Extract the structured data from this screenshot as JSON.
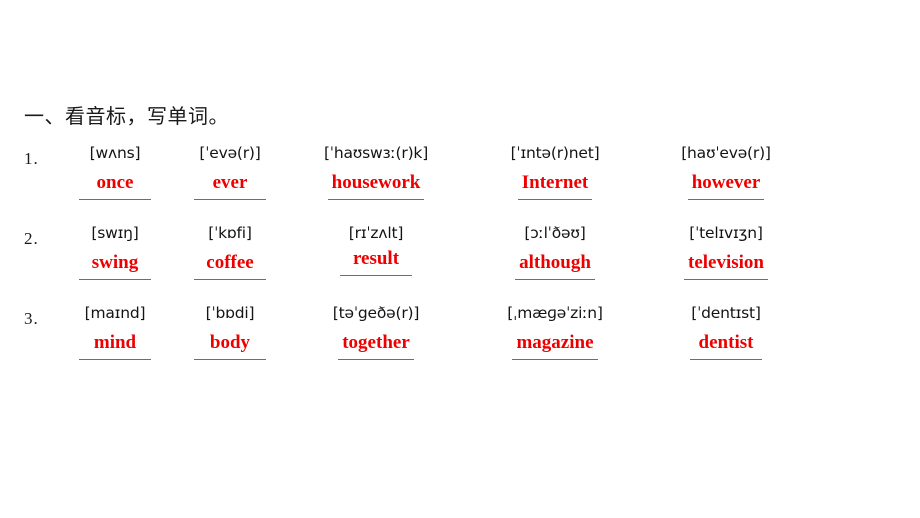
{
  "title": "一、看音标，写单词。",
  "accent_color": "#ee0000",
  "text_color": "#141414",
  "rule_color": "#6e6e6e",
  "background": "#ffffff",
  "rows": [
    {
      "number": "1.",
      "items": [
        {
          "phonetic": "[wʌns]",
          "answer": "once"
        },
        {
          "phonetic": "[ˈevə(r)]",
          "answer": "ever"
        },
        {
          "phonetic": "[ˈhaʊswɜː(r)k]",
          "answer": "housework"
        },
        {
          "phonetic": "[ˈɪntə(r)net]",
          "answer": "Internet"
        },
        {
          "phonetic": "[haʊˈevə(r)]",
          "answer": "however"
        }
      ]
    },
    {
      "number": "2.",
      "items": [
        {
          "phonetic": "[swɪŋ]",
          "answer": "swing"
        },
        {
          "phonetic": "[ˈkɒfi]",
          "answer": "coffee"
        },
        {
          "phonetic": "[rɪˈzʌlt]",
          "answer": "result"
        },
        {
          "phonetic": "[ɔːlˈðəʊ]",
          "answer": "although"
        },
        {
          "phonetic": "[ˈtelɪvɪʒn]",
          "answer": "television"
        }
      ]
    },
    {
      "number": "3.",
      "items": [
        {
          "phonetic": "[maɪnd]",
          "answer": "mind"
        },
        {
          "phonetic": "[ˈbɒdi]",
          "answer": "body"
        },
        {
          "phonetic": "[təˈgeðə(r)]",
          "answer": "together"
        },
        {
          "phonetic": "[ˌmæɡəˈziːn]",
          "answer": "magazine"
        },
        {
          "phonetic": "[ˈdentɪst]",
          "answer": "dentist"
        }
      ]
    }
  ]
}
